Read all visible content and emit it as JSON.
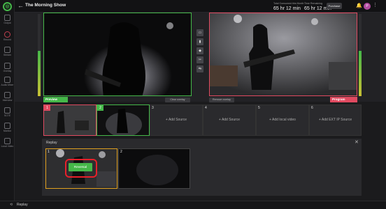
{
  "app": {
    "title": "The Morning Show",
    "logo_glyph": "◎",
    "accent_green": "#45b849",
    "accent_red": "#e04a60"
  },
  "sidebar": {
    "items": [
      {
        "label": "Output",
        "icon": "output-icon"
      },
      {
        "label": "Record",
        "icon": "record-icon"
      },
      {
        "label": "Stream",
        "icon": "stream-icon"
      },
      {
        "label": "Overlay",
        "icon": "overlay-icon"
      },
      {
        "label": "Audio Mixer",
        "icon": "audio-mixer-icon"
      },
      {
        "label": "Interview",
        "icon": "interview-icon"
      },
      {
        "label": "SCTE",
        "icon": "scte-icon"
      },
      {
        "label": "Monitor",
        "icon": "monitor-icon"
      },
      {
        "label": "Local Video",
        "icon": "local-video-icon"
      }
    ]
  },
  "topbar": {
    "back": "←",
    "consumed_label": "Total Consumed this Month",
    "consumed_value": "65 hr 12 min",
    "remaining_label": "Time Remaining",
    "remaining_value": "65 hr 12 min",
    "purchase": "Purchase",
    "bell": "🔔",
    "avatar": "P",
    "more": "⋮"
  },
  "stage": {
    "preview_label": "Preview",
    "program_label": "Program",
    "clear_overlay": "Clear overlay",
    "remove_overlay": "Remove overlay",
    "transitions": [
      {
        "glyph": "▭",
        "label": "FL"
      },
      {
        "glyph": "▮",
        "label": "TF"
      },
      {
        "glyph": "◆",
        "label": "TT"
      },
      {
        "glyph": "✂",
        "label": "Cut"
      },
      {
        "glyph": "⇆",
        "label": "Switch"
      }
    ],
    "preview_meter_level": 0.55,
    "program_meter_level": 0.55
  },
  "sources": [
    {
      "num": "1",
      "add_label": ""
    },
    {
      "num": "2",
      "add_label": ""
    },
    {
      "num": "3",
      "add_label": "+ Add Source"
    },
    {
      "num": "4",
      "add_label": "+ Add Source"
    },
    {
      "num": "5",
      "add_label": "+ Add local video"
    },
    {
      "num": "6",
      "add_label": "+ Add EXT IP Source"
    }
  ],
  "replay": {
    "title": "Replay",
    "close": "✕",
    "clips": [
      {
        "num": "1",
        "action": "Reversal"
      },
      {
        "num": "2"
      }
    ]
  },
  "footer": {
    "replay": "Replay"
  }
}
